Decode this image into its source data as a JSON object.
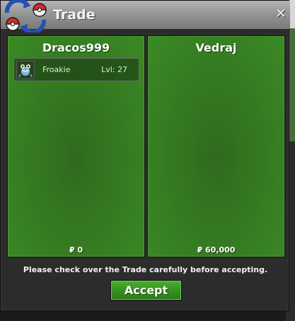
{
  "window": {
    "title": "Trade",
    "close_glyph": "✕"
  },
  "left_panel": {
    "player_name": "Dracos999",
    "items": [
      {
        "name": "Froakie",
        "level": "Lvl: 27",
        "icon": "froakie-sprite"
      }
    ],
    "money": "₽ 0"
  },
  "right_panel": {
    "player_name": "Vedraj",
    "items": [],
    "money": "₽ 60,000"
  },
  "footer": {
    "notice": "Please check over the Trade carefully before accepting.",
    "accept_label": "Accept"
  },
  "colors": {
    "panel_green": "#367d22",
    "button_green": "#35901f",
    "title_bar": "#8d8d8d"
  }
}
